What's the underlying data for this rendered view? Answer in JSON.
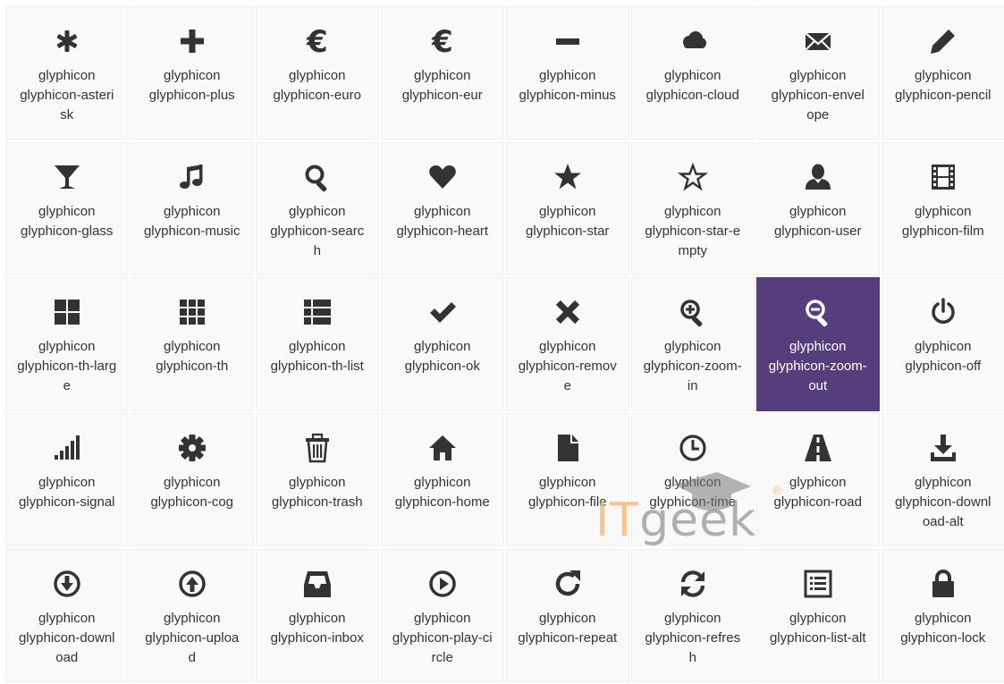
{
  "icons": [
    {
      "line1": "glyphicon",
      "line2": "glyphicon-asterisk",
      "icon": "asterisk-icon"
    },
    {
      "line1": "glyphicon",
      "line2": "glyphicon-plus",
      "icon": "plus-icon"
    },
    {
      "line1": "glyphicon",
      "line2": "glyphicon-euro",
      "icon": "euro-icon"
    },
    {
      "line1": "glyphicon",
      "line2": "glyphicon-eur",
      "icon": "eur-icon"
    },
    {
      "line1": "glyphicon",
      "line2": "glyphicon-minus",
      "icon": "minus-icon"
    },
    {
      "line1": "glyphicon",
      "line2": "glyphicon-cloud",
      "icon": "cloud-icon"
    },
    {
      "line1": "glyphicon",
      "line2": "glyphicon-envelope",
      "icon": "envelope-icon"
    },
    {
      "line1": "glyphicon",
      "line2": "glyphicon-pencil",
      "icon": "pencil-icon"
    },
    {
      "line1": "glyphicon",
      "line2": "glyphicon-glass",
      "icon": "glass-icon"
    },
    {
      "line1": "glyphicon",
      "line2": "glyphicon-music",
      "icon": "music-icon"
    },
    {
      "line1": "glyphicon",
      "line2": "glyphicon-search",
      "icon": "search-icon"
    },
    {
      "line1": "glyphicon",
      "line2": "glyphicon-heart",
      "icon": "heart-icon"
    },
    {
      "line1": "glyphicon",
      "line2": "glyphicon-star",
      "icon": "star-icon"
    },
    {
      "line1": "glyphicon",
      "line2": "glyphicon-star-empty",
      "icon": "star-empty-icon"
    },
    {
      "line1": "glyphicon",
      "line2": "glyphicon-user",
      "icon": "user-icon"
    },
    {
      "line1": "glyphicon",
      "line2": "glyphicon-film",
      "icon": "film-icon"
    },
    {
      "line1": "glyphicon",
      "line2": "glyphicon-th-large",
      "icon": "th-large-icon"
    },
    {
      "line1": "glyphicon",
      "line2": "glyphicon-th",
      "icon": "th-icon"
    },
    {
      "line1": "glyphicon",
      "line2": "glyphicon-th-list",
      "icon": "th-list-icon"
    },
    {
      "line1": "glyphicon",
      "line2": "glyphicon-ok",
      "icon": "ok-icon"
    },
    {
      "line1": "glyphicon",
      "line2": "glyphicon-remove",
      "icon": "remove-icon"
    },
    {
      "line1": "glyphicon",
      "line2": "glyphicon-zoom-in",
      "icon": "zoom-in-icon"
    },
    {
      "line1": "glyphicon",
      "line2": "glyphicon-zoom-out",
      "icon": "zoom-out-icon",
      "active": true
    },
    {
      "line1": "glyphicon",
      "line2": "glyphicon-off",
      "icon": "off-icon"
    },
    {
      "line1": "glyphicon",
      "line2": "glyphicon-signal",
      "icon": "signal-icon"
    },
    {
      "line1": "glyphicon",
      "line2": "glyphicon-cog",
      "icon": "cog-icon"
    },
    {
      "line1": "glyphicon",
      "line2": "glyphicon-trash",
      "icon": "trash-icon"
    },
    {
      "line1": "glyphicon",
      "line2": "glyphicon-home",
      "icon": "home-icon"
    },
    {
      "line1": "glyphicon",
      "line2": "glyphicon-file",
      "icon": "file-icon"
    },
    {
      "line1": "glyphicon",
      "line2": "glyphicon-time",
      "icon": "time-icon"
    },
    {
      "line1": "glyphicon",
      "line2": "glyphicon-road",
      "icon": "road-icon"
    },
    {
      "line1": "glyphicon",
      "line2": "glyphicon-download-alt",
      "icon": "download-alt-icon"
    },
    {
      "line1": "glyphicon",
      "line2": "glyphicon-download",
      "icon": "download-icon"
    },
    {
      "line1": "glyphicon",
      "line2": "glyphicon-upload",
      "icon": "upload-icon"
    },
    {
      "line1": "glyphicon",
      "line2": "glyphicon-inbox",
      "icon": "inbox-icon"
    },
    {
      "line1": "glyphicon",
      "line2": "glyphicon-play-circle",
      "icon": "play-circle-icon"
    },
    {
      "line1": "glyphicon",
      "line2": "glyphicon-repeat",
      "icon": "repeat-icon"
    },
    {
      "line1": "glyphicon",
      "line2": "glyphicon-refresh",
      "icon": "refresh-icon"
    },
    {
      "line1": "glyphicon",
      "line2": "glyphicon-list-alt",
      "icon": "list-alt-icon"
    },
    {
      "line1": "glyphicon",
      "line2": "glyphicon-lock",
      "icon": "lock-icon"
    }
  ],
  "watermark": {
    "it": "IT",
    "geek": "geek",
    "mark": "®"
  },
  "colors": {
    "active_bg": "#563d7c",
    "cell_bg": "#f9f9f9",
    "text": "#333333"
  }
}
